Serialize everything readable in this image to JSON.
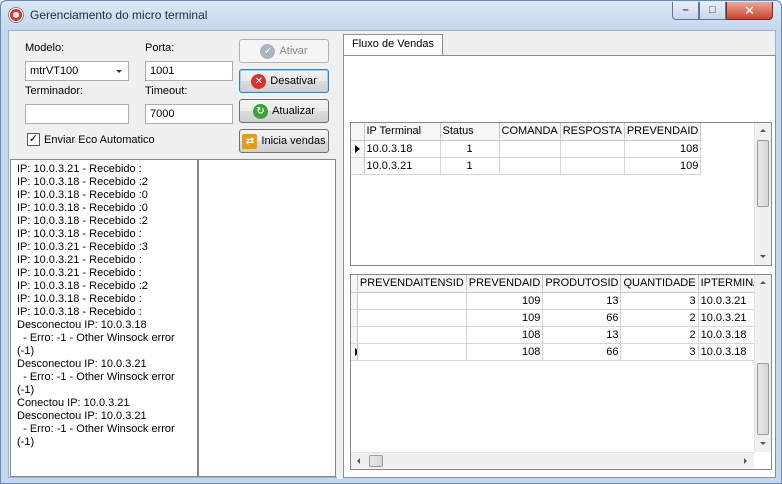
{
  "window": {
    "title": "Gerenciamento do micro terminal"
  },
  "form": {
    "modelo_label": "Modelo:",
    "modelo_value": "mtrVT100",
    "porta_label": "Porta:",
    "porta_value": "1001",
    "terminador_label": "Terminador:",
    "terminador_value": "",
    "timeout_label": "Timeout:",
    "timeout_value": "7000",
    "eco_label": "Enviar Eco Automatico",
    "eco_checked": true
  },
  "buttons": {
    "ativar": "Ativar",
    "desativar": "Desativar",
    "atualizar": "Atualizar",
    "inicia_vendas": "Inicia vendas"
  },
  "log": [
    "IP: 10.0.3.21 - Recebido :",
    "IP: 10.0.3.18 - Recebido :2",
    "IP: 10.0.3.18 - Recebido :0",
    "IP: 10.0.3.18 - Recebido :0",
    "IP: 10.0.3.18 - Recebido :2",
    "IP: 10.0.3.18 - Recebido :",
    "IP: 10.0.3.21 - Recebido :3",
    "IP: 10.0.3.21 - Recebido :",
    "IP: 10.0.3.21 - Recebido :",
    "IP: 10.0.3.18 - Recebido :2",
    "IP: 10.0.3.18 - Recebido :",
    "IP: 10.0.3.18 - Recebido :",
    "Desconectou IP: 10.0.3.18",
    "  - Erro: -1 - Other Winsock error",
    "(-1)",
    "Desconectou IP: 10.0.3.21",
    "  - Erro: -1 - Other Winsock error",
    "(-1)",
    "Conectou IP: 10.0.3.21",
    "Desconectou IP: 10.0.3.21",
    "  - Erro: -1 - Other Winsock error",
    "(-1)"
  ],
  "tab": {
    "label": "Fluxo de Vendas"
  },
  "grid1": {
    "columns": [
      "IP Terminal",
      "Status",
      "COMANDA",
      "RESPOSTA",
      "PREVENDAID"
    ],
    "rows": [
      [
        "10.0.3.18",
        "1",
        "",
        "",
        "108"
      ],
      [
        "10.0.3.21",
        "1",
        "",
        "",
        "109"
      ]
    ],
    "current_row": 0
  },
  "grid2": {
    "columns": [
      "PREVENDAITENSID",
      "PREVENDAID",
      "PRODUTOSID",
      "QUANTIDADE",
      "IPTERMINAL"
    ],
    "rows": [
      [
        "",
        "109",
        "13",
        "3",
        "10.0.3.21"
      ],
      [
        "",
        "109",
        "66",
        "2",
        "10.0.3.21"
      ],
      [
        "",
        "108",
        "13",
        "2",
        "10.0.3.18"
      ],
      [
        "",
        "108",
        "66",
        "3",
        "10.0.3.18"
      ]
    ],
    "current_row": 3
  },
  "colors": {
    "title_bg": "#c5d8ee",
    "close_button": "#c6452e",
    "desativar_icon": "#d8342a",
    "atualizar_icon": "#3aa335",
    "ativar_icon": "#a8b6c4"
  }
}
